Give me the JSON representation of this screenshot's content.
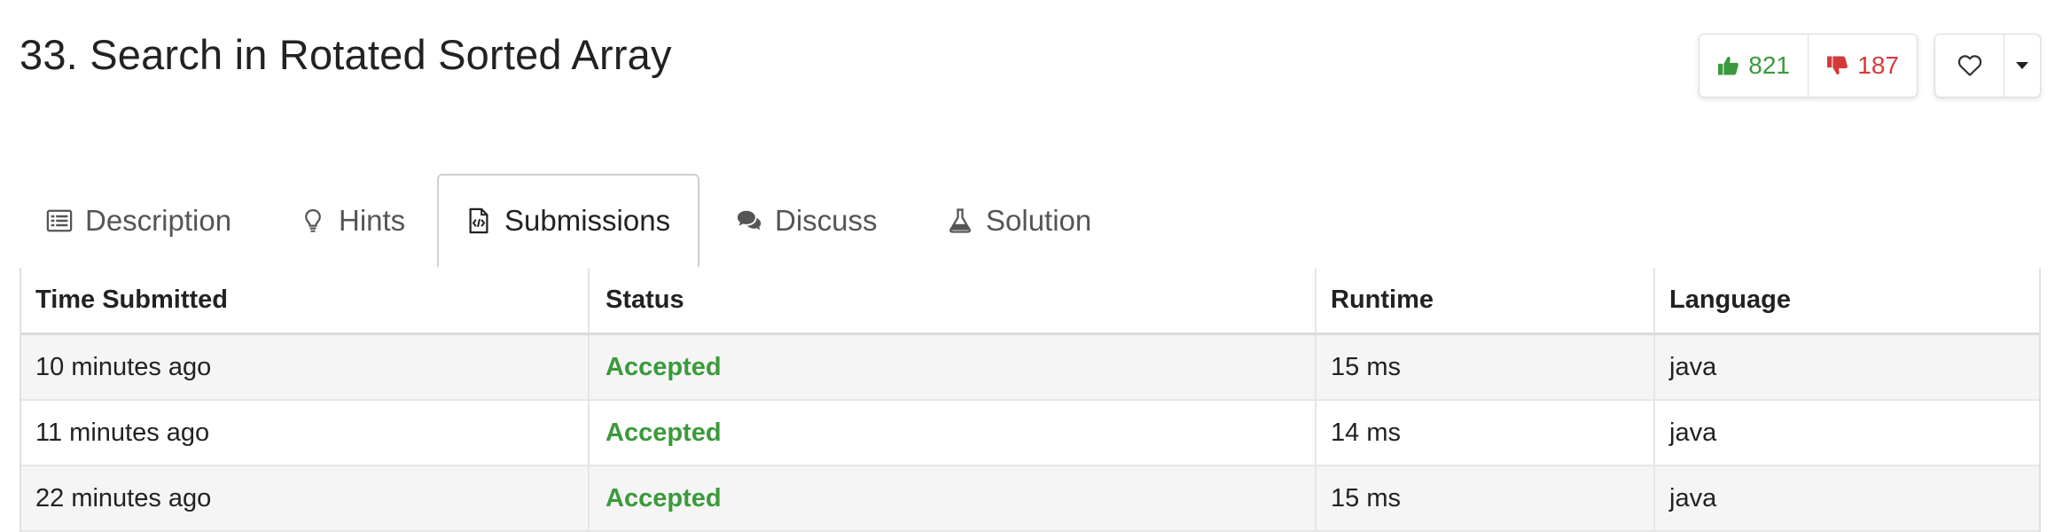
{
  "problem": {
    "title": "33. Search in Rotated Sorted Array"
  },
  "votes": {
    "likes": "821",
    "dislikes": "187",
    "like_icon": "thumbs-up-icon",
    "dislike_icon": "thumbs-down-icon",
    "like_color": "#3b9a3b",
    "dislike_color": "#d33b3b"
  },
  "actions": {
    "favorite_icon": "heart-icon",
    "more_icon": "caret-down-icon"
  },
  "tabs": [
    {
      "label": "Description",
      "icon": "list-icon",
      "active": false
    },
    {
      "label": "Hints",
      "icon": "lightbulb-icon",
      "active": false
    },
    {
      "label": "Submissions",
      "icon": "code-file-icon",
      "active": true
    },
    {
      "label": "Discuss",
      "icon": "comments-icon",
      "active": false
    },
    {
      "label": "Solution",
      "icon": "flask-icon",
      "active": false
    }
  ],
  "table": {
    "headers": [
      "Time Submitted",
      "Status",
      "Runtime",
      "Language"
    ],
    "rows": [
      {
        "time": "10 minutes ago",
        "status": "Accepted",
        "runtime": "15 ms",
        "language": "java"
      },
      {
        "time": "11 minutes ago",
        "status": "Accepted",
        "runtime": "14 ms",
        "language": "java"
      },
      {
        "time": "22 minutes ago",
        "status": "Accepted",
        "runtime": "15 ms",
        "language": "java"
      }
    ],
    "accepted_color": "#3a9a3a"
  }
}
